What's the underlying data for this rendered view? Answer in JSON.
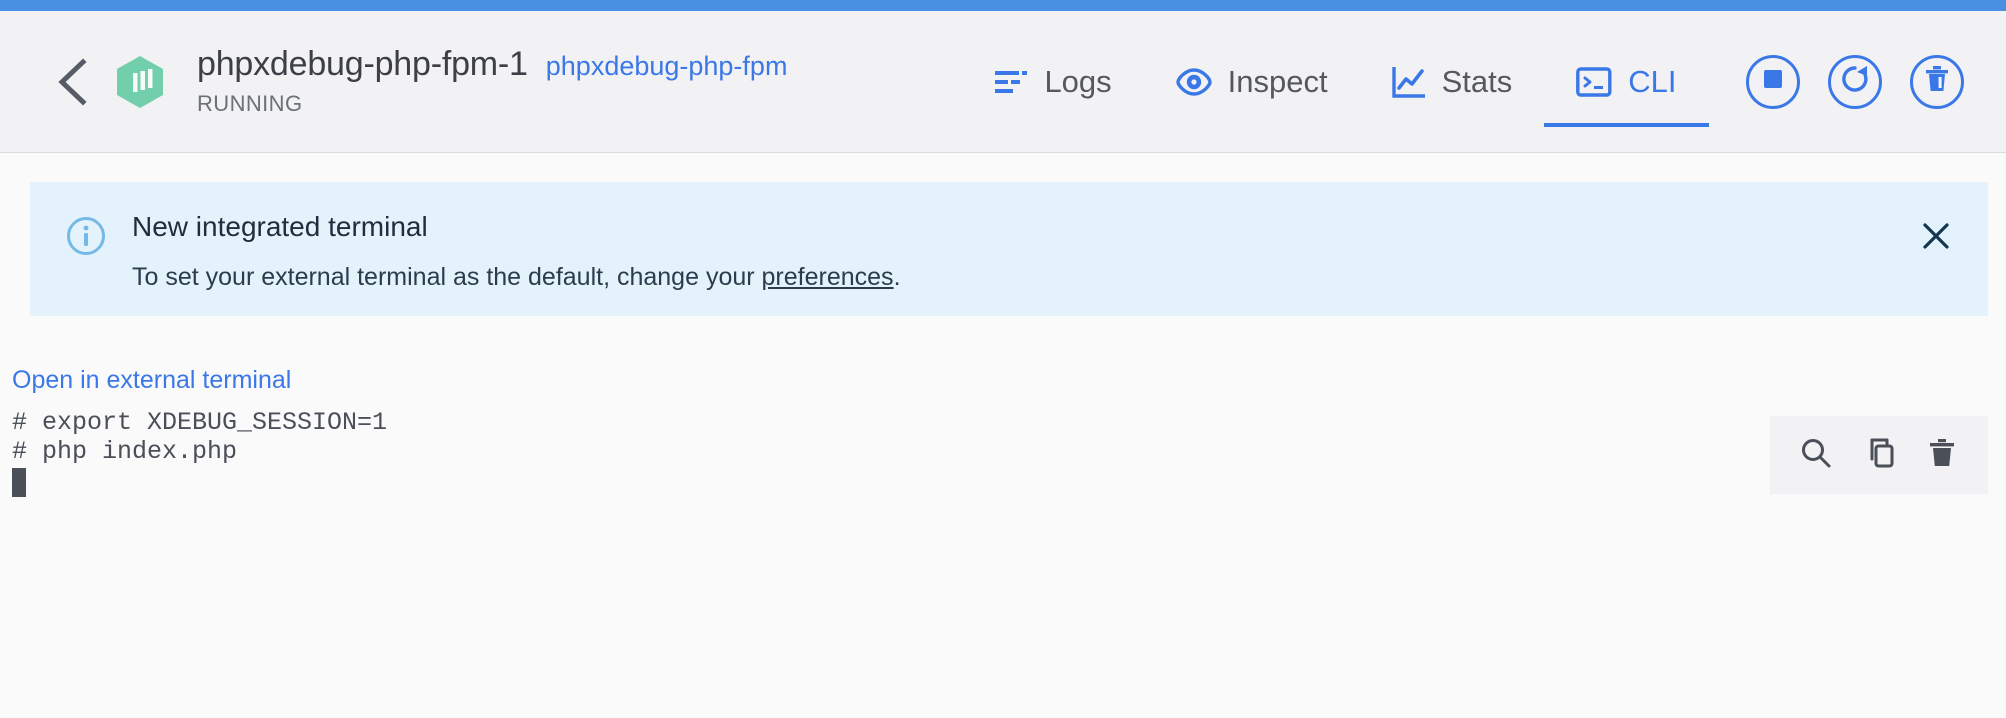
{
  "theme": {
    "accent_blue": "#4a90e2",
    "link_blue": "#3b78e7",
    "header_bg": "#f2f2f4",
    "banner_bg": "#e3f2fb",
    "content_bg": "#fafafa",
    "container_green": "#72cfab",
    "terminal_text": "#4a4f58"
  },
  "header": {
    "back_icon": "chevron-left-icon",
    "container_icon": "container-hexagon-icon",
    "title": "phpxdebug-php-fpm-1",
    "service_link": "phpxdebug-php-fpm",
    "status": "RUNNING",
    "tabs": [
      {
        "label": "Logs",
        "icon": "logs-lines-icon",
        "active": false
      },
      {
        "label": "Inspect",
        "icon": "eye-icon",
        "active": false
      },
      {
        "label": "Stats",
        "icon": "chart-line-icon",
        "active": false
      },
      {
        "label": "CLI",
        "icon": "terminal-prompt-icon",
        "active": true
      }
    ],
    "actions": [
      {
        "name": "stop-button",
        "icon": "stop-square-icon"
      },
      {
        "name": "restart-button",
        "icon": "restart-arrow-icon"
      },
      {
        "name": "delete-button",
        "icon": "trash-icon"
      }
    ]
  },
  "banner": {
    "icon": "info-circle-icon",
    "title": "New integrated terminal",
    "body_before": "To set your external terminal as the default, change your ",
    "body_link": "preferences",
    "body_after": ".",
    "close_icon": "close-x-icon"
  },
  "terminal": {
    "external_link": "Open in external terminal",
    "lines": [
      "# export XDEBUG_SESSION=1",
      "# php index.php"
    ],
    "cursor": "block-cursor",
    "tools": [
      {
        "name": "search-terminal-button",
        "icon": "search-icon"
      },
      {
        "name": "copy-terminal-button",
        "icon": "copy-icon"
      },
      {
        "name": "clear-terminal-button",
        "icon": "trash-icon"
      }
    ]
  }
}
